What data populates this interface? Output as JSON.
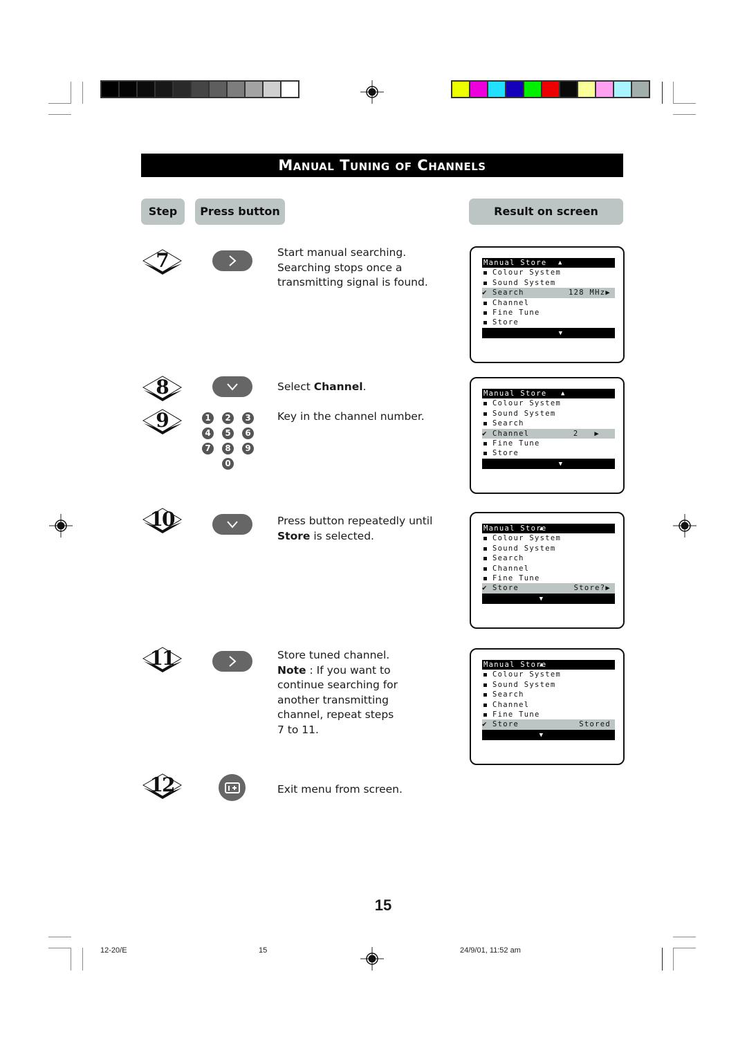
{
  "print_marks": {
    "grayscale_swatches": [
      "#000000",
      "#040404",
      "#0c0c0c",
      "#181818",
      "#2a2a2a",
      "#454545",
      "#5e5e5e",
      "#7d7d7d",
      "#a3a3a3",
      "#cfcfcf",
      "#ffffff"
    ],
    "color_swatches": [
      "#eeff00",
      "#ee00dd",
      "#22e0ff",
      "#1400bb",
      "#00ee00",
      "#ee0000",
      "#0a0a0a",
      "#f9ff99",
      "#ffa0f0",
      "#aaf4ff",
      "#a2aeac"
    ]
  },
  "title": "Manual Tuning of Channels",
  "headers": {
    "step": "Step",
    "press_button": "Press button",
    "result": "Result on screen"
  },
  "steps": [
    {
      "number": "7",
      "button": "right-arrow",
      "text": "Start manual searching. Searching stops once a transmitting signal is found."
    },
    {
      "number": "8",
      "button": "down-arrow",
      "text_prefix": "Select ",
      "text_bold": "Channel",
      "text_suffix": "."
    },
    {
      "number": "9",
      "button": "numeric-keypad",
      "text": "Key in the channel number.",
      "keys": [
        "1",
        "2",
        "3",
        "4",
        "5",
        "6",
        "7",
        "8",
        "9",
        "0"
      ]
    },
    {
      "number": "10",
      "button": "down-arrow",
      "text_line1": "Press button repeatedly until",
      "text_bold": "Store",
      "text_suffix": " is selected."
    },
    {
      "number": "11",
      "button": "right-arrow",
      "text_line1": "Store tuned  channel.",
      "note_label": "Note",
      "note_text": " : If you want to",
      "note_lines": [
        "continue searching for",
        "another transmitting",
        "channel, repeat steps",
        "7 to 11."
      ]
    },
    {
      "number": "12",
      "button": "info-menu",
      "text": "Exit menu from screen."
    }
  ],
  "screens": [
    {
      "header": "Manual Store",
      "items": [
        {
          "label": "Colour System",
          "selected": false,
          "value": ""
        },
        {
          "label": "Sound System",
          "selected": false,
          "value": ""
        },
        {
          "label": "Search",
          "selected": true,
          "value": "128 MHz"
        },
        {
          "label": "Channel",
          "selected": false,
          "value": ""
        },
        {
          "label": "Fine Tune",
          "selected": false,
          "value": ""
        },
        {
          "label": "Store",
          "selected": false,
          "value": ""
        }
      ]
    },
    {
      "header": "Manual Store",
      "items": [
        {
          "label": "Colour System",
          "selected": false,
          "value": ""
        },
        {
          "label": "Sound System",
          "selected": false,
          "value": ""
        },
        {
          "label": "Search",
          "selected": false,
          "value": ""
        },
        {
          "label": "Channel",
          "selected": true,
          "value": "2"
        },
        {
          "label": "Fine Tune",
          "selected": false,
          "value": ""
        },
        {
          "label": "Store",
          "selected": false,
          "value": ""
        }
      ]
    },
    {
      "header": "Manual Store",
      "items": [
        {
          "label": "Colour System",
          "selected": false,
          "value": ""
        },
        {
          "label": "Sound System",
          "selected": false,
          "value": ""
        },
        {
          "label": "Search",
          "selected": false,
          "value": ""
        },
        {
          "label": "Channel",
          "selected": false,
          "value": ""
        },
        {
          "label": "Fine Tune",
          "selected": false,
          "value": ""
        },
        {
          "label": "Store",
          "selected": true,
          "value": "Store?"
        }
      ]
    },
    {
      "header": "Manual Store",
      "items": [
        {
          "label": "Colour System",
          "selected": false,
          "value": ""
        },
        {
          "label": "Sound System",
          "selected": false,
          "value": ""
        },
        {
          "label": "Search",
          "selected": false,
          "value": ""
        },
        {
          "label": "Channel",
          "selected": false,
          "value": ""
        },
        {
          "label": "Fine Tune",
          "selected": false,
          "value": ""
        },
        {
          "label": "Store",
          "selected": true,
          "value": "Stored"
        }
      ]
    }
  ],
  "page_number": "15",
  "footer": {
    "doc_code": "12-20/E",
    "page": "15",
    "timestamp": "24/9/01, 11:52 am"
  }
}
